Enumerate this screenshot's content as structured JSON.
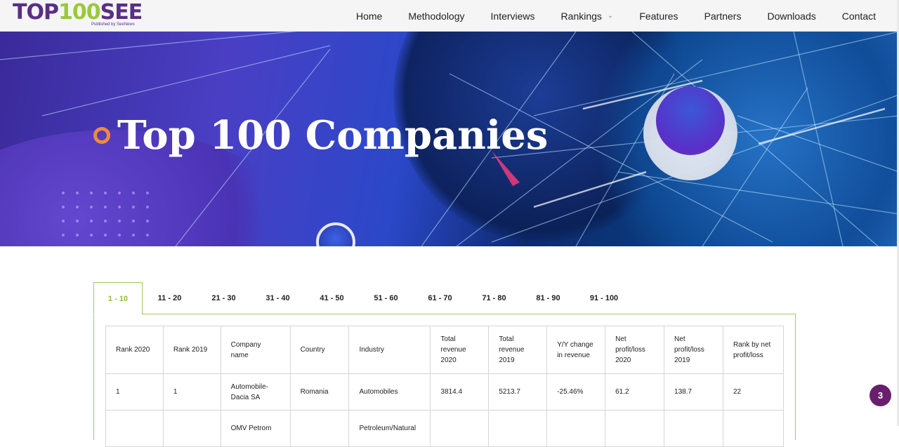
{
  "logo": {
    "part_a": "TOP",
    "part_b": "100",
    "part_c": "SEE",
    "subtitle": "Published by SeeNews"
  },
  "nav": {
    "items": [
      "Home",
      "Methodology",
      "Interviews",
      "Rankings",
      "Features",
      "Partners",
      "Downloads",
      "Contact"
    ],
    "rankings_has_dropdown": true
  },
  "hero": {
    "title": "Top 100 Companies"
  },
  "tabs": {
    "items": [
      "1 - 10",
      "11 - 20",
      "21 - 30",
      "31 - 40",
      "41 - 50",
      "51 - 60",
      "61 - 70",
      "71 - 80",
      "81 - 90",
      "91 - 100"
    ],
    "active": "1 - 10"
  },
  "table": {
    "headers": [
      "Rank 2020",
      "Rank 2019",
      "Company name",
      "Country",
      "Industry",
      "Total revenue 2020",
      "Total revenue 2019",
      "Y/Y change in revenue",
      "Net profit/loss 2020",
      "Net profit/loss 2019",
      "Rank by net profit/loss"
    ],
    "rows": [
      [
        "1",
        "1",
        "Automobile-Dacia SA",
        "Romania",
        "Automobiles",
        "3814.4",
        "5213.7",
        "-25.46%",
        "61.2",
        "138.7",
        "22"
      ],
      [
        "",
        "",
        "OMV Petrom",
        "",
        "Petroleum/Natural",
        "",
        "",
        "",
        "",
        "",
        ""
      ]
    ]
  },
  "fab": {
    "count": "3"
  },
  "colors": {
    "accent_green": "#9bcf55",
    "brand_purple": "#5a2f86",
    "hero_dot": "#f08a3c",
    "fab": "#6a1f6e"
  }
}
